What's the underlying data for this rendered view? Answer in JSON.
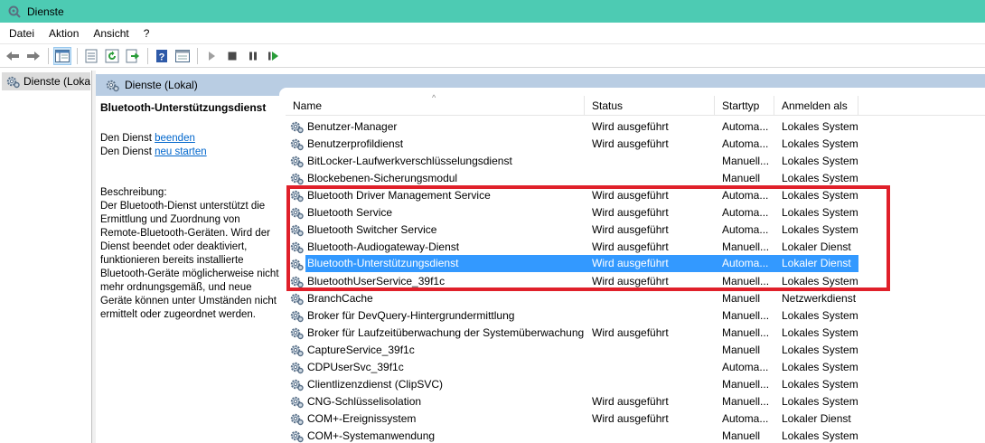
{
  "window": {
    "title": "Dienste"
  },
  "menu": [
    "Datei",
    "Aktion",
    "Ansicht",
    "?"
  ],
  "toolbar": {
    "buttons": [
      "back-icon",
      "forward-icon",
      "show-tree-icon",
      "properties-icon",
      "refresh-icon",
      "export-icon",
      "help-icon",
      "console-icon",
      "play-icon",
      "stop-icon",
      "pause-icon",
      "restart-icon"
    ]
  },
  "tree": {
    "root_label": "Dienste (Loka"
  },
  "panel": {
    "title": "Dienste (Lokal)"
  },
  "details": {
    "service_name": "Bluetooth-Unterstützungsdienst",
    "stop_prefix": "Den Dienst ",
    "stop_link": "beenden",
    "restart_prefix": "Den Dienst ",
    "restart_link": "neu starten",
    "description_label": "Beschreibung:",
    "description": "Der Bluetooth-Dienst unterstützt die Ermittlung und Zuordnung von Remote-Bluetooth-Geräten. Wird der Dienst beendet oder deaktiviert, funktionieren bereits installierte Bluetooth-Geräte möglicherweise nicht mehr ordnungsgemäß, und neue Geräte können unter Umständen nicht ermittelt oder zugeordnet werden."
  },
  "columns": {
    "name": "Name",
    "status": "Status",
    "starttype": "Starttyp",
    "logon": "Anmelden als"
  },
  "services": [
    {
      "name": "Benutzer-Manager",
      "status": "Wird ausgeführt",
      "starttype": "Automa...",
      "logon": "Lokales System"
    },
    {
      "name": "Benutzerprofildienst",
      "status": "Wird ausgeführt",
      "starttype": "Automa...",
      "logon": "Lokales System"
    },
    {
      "name": "BitLocker-Laufwerkverschlüsselungsdienst",
      "status": "",
      "starttype": "Manuell...",
      "logon": "Lokales System"
    },
    {
      "name": "Blockebenen-Sicherungsmodul",
      "status": "",
      "starttype": "Manuell",
      "logon": "Lokales System"
    },
    {
      "name": "Bluetooth Driver Management Service",
      "status": "Wird ausgeführt",
      "starttype": "Automa...",
      "logon": "Lokales System"
    },
    {
      "name": "Bluetooth Service",
      "status": "Wird ausgeführt",
      "starttype": "Automa...",
      "logon": "Lokales System"
    },
    {
      "name": "Bluetooth Switcher Service",
      "status": "Wird ausgeführt",
      "starttype": "Automa...",
      "logon": "Lokales System"
    },
    {
      "name": "Bluetooth-Audiogateway-Dienst",
      "status": "Wird ausgeführt",
      "starttype": "Manuell...",
      "logon": "Lokaler Dienst"
    },
    {
      "name": "Bluetooth-Unterstützungsdienst",
      "status": "Wird ausgeführt",
      "starttype": "Automa...",
      "logon": "Lokaler Dienst",
      "selected": true
    },
    {
      "name": "BluetoothUserService_39f1c",
      "status": "Wird ausgeführt",
      "starttype": "Manuell...",
      "logon": "Lokales System"
    },
    {
      "name": "BranchCache",
      "status": "",
      "starttype": "Manuell",
      "logon": "Netzwerkdienst"
    },
    {
      "name": "Broker für DevQuery-Hintergrundermittlung",
      "status": "",
      "starttype": "Manuell...",
      "logon": "Lokales System"
    },
    {
      "name": "Broker für Laufzeitüberwachung der Systemüberwachung",
      "status": "Wird ausgeführt",
      "starttype": "Manuell...",
      "logon": "Lokales System"
    },
    {
      "name": "CaptureService_39f1c",
      "status": "",
      "starttype": "Manuell",
      "logon": "Lokales System"
    },
    {
      "name": "CDPUserSvc_39f1c",
      "status": "",
      "starttype": "Automa...",
      "logon": "Lokales System"
    },
    {
      "name": "Clientlizenzdienst (ClipSVC)",
      "status": "",
      "starttype": "Manuell...",
      "logon": "Lokales System"
    },
    {
      "name": "CNG-Schlüsselisolation",
      "status": "Wird ausgeführt",
      "starttype": "Manuell...",
      "logon": "Lokales System"
    },
    {
      "name": "COM+-Ereignissystem",
      "status": "Wird ausgeführt",
      "starttype": "Automa...",
      "logon": "Lokaler Dienst"
    },
    {
      "name": "COM+-Systemanwendung",
      "status": "",
      "starttype": "Manuell",
      "logon": "Lokales System"
    }
  ],
  "colors": {
    "titlebar": "#4dcbb3",
    "panel_header": "#b9cde3",
    "selection": "#3399ff",
    "highlight": "#e0202a",
    "link": "#0066cc"
  }
}
